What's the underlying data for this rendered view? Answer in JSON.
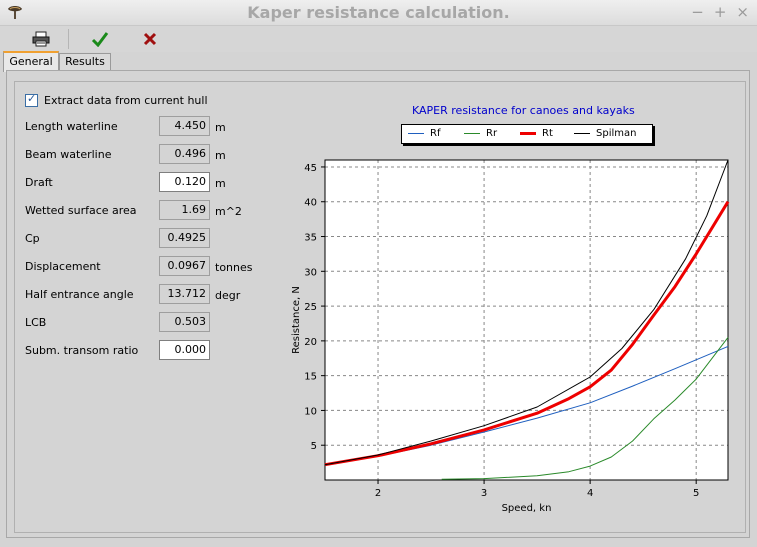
{
  "window": {
    "title": "Kaper resistance calculation."
  },
  "toolbar": {
    "print_icon": "printer-icon",
    "ok_icon": "green-checkmark-icon",
    "cancel_icon": "red-x-icon"
  },
  "tabs": [
    {
      "label": "General",
      "active": true
    },
    {
      "label": "Results",
      "active": false
    }
  ],
  "form": {
    "extract_label": "Extract data from current hull",
    "extract_checked": true,
    "rows": [
      {
        "label": "Length waterline",
        "value": "4.450",
        "unit": "m",
        "editable": false
      },
      {
        "label": "Beam waterline",
        "value": "0.496",
        "unit": "m",
        "editable": false
      },
      {
        "label": "Draft",
        "value": "0.120",
        "unit": "m",
        "editable": true
      },
      {
        "label": "Wetted surface area",
        "value": "1.69",
        "unit": "m^2",
        "editable": false
      },
      {
        "label": "Cp",
        "value": "0.4925",
        "unit": "",
        "editable": false
      },
      {
        "label": "Displacement",
        "value": "0.0967",
        "unit": "tonnes",
        "editable": false
      },
      {
        "label": "Half entrance angle",
        "value": "13.712",
        "unit": "degr",
        "editable": false
      },
      {
        "label": "LCB",
        "value": "0.503",
        "unit": "",
        "editable": false
      },
      {
        "label": "Subm. transom ratio",
        "value": "0.000",
        "unit": "",
        "editable": true
      }
    ]
  },
  "colors": {
    "rf": "#1f5fbf",
    "rr": "#2a8a2a",
    "rt": "#ee0000",
    "spilman": "#000000",
    "title": "#0000cc"
  },
  "chart_data": {
    "type": "line",
    "title": "KAPER resistance for canoes and kayaks",
    "xlabel": "Speed, kn",
    "ylabel": "Resistance, N",
    "xlim": [
      1.5,
      5.3
    ],
    "ylim": [
      0,
      46
    ],
    "xticks": [
      2,
      3,
      4,
      5
    ],
    "yticks": [
      5,
      10,
      15,
      20,
      25,
      30,
      35,
      40,
      45
    ],
    "grid": true,
    "legend_position": "top",
    "series": [
      {
        "name": "Rf",
        "color": "#1f5fbf",
        "width": 1,
        "x": [
          1.5,
          2.0,
          2.5,
          3.0,
          3.5,
          4.0,
          4.4,
          4.8,
          5.3
        ],
        "y": [
          2.1,
          3.4,
          5.0,
          6.9,
          8.9,
          11.1,
          13.5,
          16.0,
          19.2
        ]
      },
      {
        "name": "Rr",
        "color": "#2a8a2a",
        "width": 1,
        "x": [
          2.6,
          3.0,
          3.5,
          3.8,
          4.0,
          4.2,
          4.4,
          4.6,
          4.8,
          5.0,
          5.3
        ],
        "y": [
          0.1,
          0.2,
          0.6,
          1.2,
          2.0,
          3.3,
          5.6,
          8.8,
          11.5,
          14.5,
          20.5
        ]
      },
      {
        "name": "Rt",
        "color": "#ee0000",
        "width": 3,
        "x": [
          1.5,
          2.0,
          2.5,
          3.0,
          3.5,
          3.8,
          4.0,
          4.2,
          4.4,
          4.6,
          4.8,
          5.0,
          5.3
        ],
        "y": [
          2.2,
          3.5,
          5.2,
          7.2,
          9.6,
          11.7,
          13.4,
          15.8,
          19.5,
          23.7,
          27.8,
          32.5,
          40.0
        ]
      },
      {
        "name": "Spilman",
        "color": "#000000",
        "width": 1,
        "x": [
          1.5,
          2.0,
          2.5,
          3.0,
          3.5,
          4.0,
          4.3,
          4.6,
          4.9,
          5.1,
          5.3
        ],
        "y": [
          2.2,
          3.6,
          5.6,
          7.8,
          10.5,
          14.8,
          18.9,
          24.5,
          31.8,
          38.0,
          46.0
        ]
      }
    ]
  }
}
